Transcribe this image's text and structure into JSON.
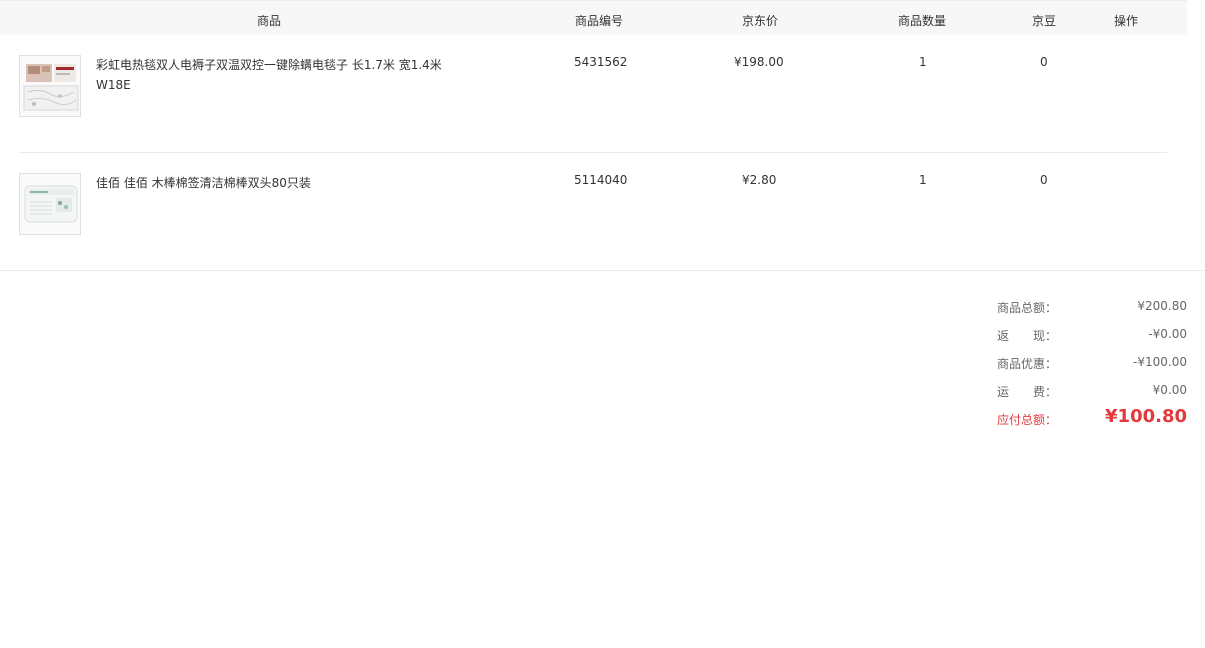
{
  "table": {
    "headers": {
      "product": "商品",
      "code": "商品编号",
      "price": "京东价",
      "qty": "商品数量",
      "beans": "京豆",
      "action": "操作"
    },
    "rows": [
      {
        "name": "彩虹电热毯双人电褥子双温双控一键除螨电毯子 长1.7米 宽1.4米 W18E",
        "code": "5431562",
        "price": "¥198.00",
        "qty": "1",
        "beans": "0",
        "thumb_icon": "electric-blanket-product-image"
      },
      {
        "name": "佳佰 佳佰 木棒棉签清洁棉棒双头80只装",
        "code": "5114040",
        "price": "¥2.80",
        "qty": "1",
        "beans": "0",
        "thumb_icon": "cotton-swab-product-image"
      }
    ]
  },
  "summary": {
    "subtotal_label": "商品总额：",
    "subtotal": "¥200.80",
    "cashback_label": "返　　现：",
    "cashback": "-¥0.00",
    "discount_label": "商品优惠：",
    "discount": "-¥100.00",
    "shipping_label": "运　　费：",
    "shipping": "¥0.00",
    "total_label": "应付总额：",
    "total": "¥100.80"
  },
  "colors": {
    "accent": "#e4393c",
    "header_bg": "#f7f7f7"
  }
}
